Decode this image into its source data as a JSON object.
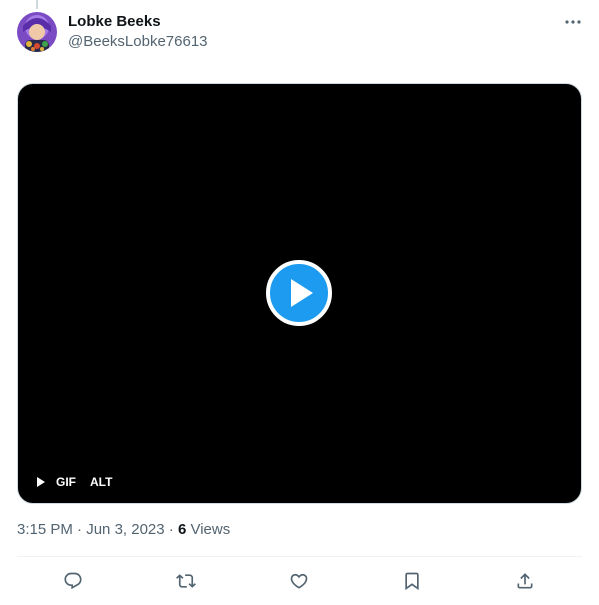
{
  "author": {
    "display_name": "Lobke Beeks",
    "handle": "@BeeksLobke76613"
  },
  "icons": {
    "more": "more-horizontal-icon",
    "play": "play-icon",
    "reply": "reply-icon",
    "retweet": "retweet-icon",
    "like": "like-icon",
    "bookmark": "bookmark-icon",
    "share": "share-icon"
  },
  "media": {
    "badge_gif": "GIF",
    "badge_alt": "ALT"
  },
  "meta": {
    "time": "3:15 PM",
    "separator_1": " · ",
    "date": "Jun 3, 2023",
    "separator_2": " · ",
    "views_count": "6",
    "views_label": " Views"
  },
  "colors": {
    "accent": "#1d9bf0",
    "text_primary": "#0f1419",
    "text_secondary": "#536471",
    "media_bg": "#000000",
    "divider": "#eff3f4"
  }
}
